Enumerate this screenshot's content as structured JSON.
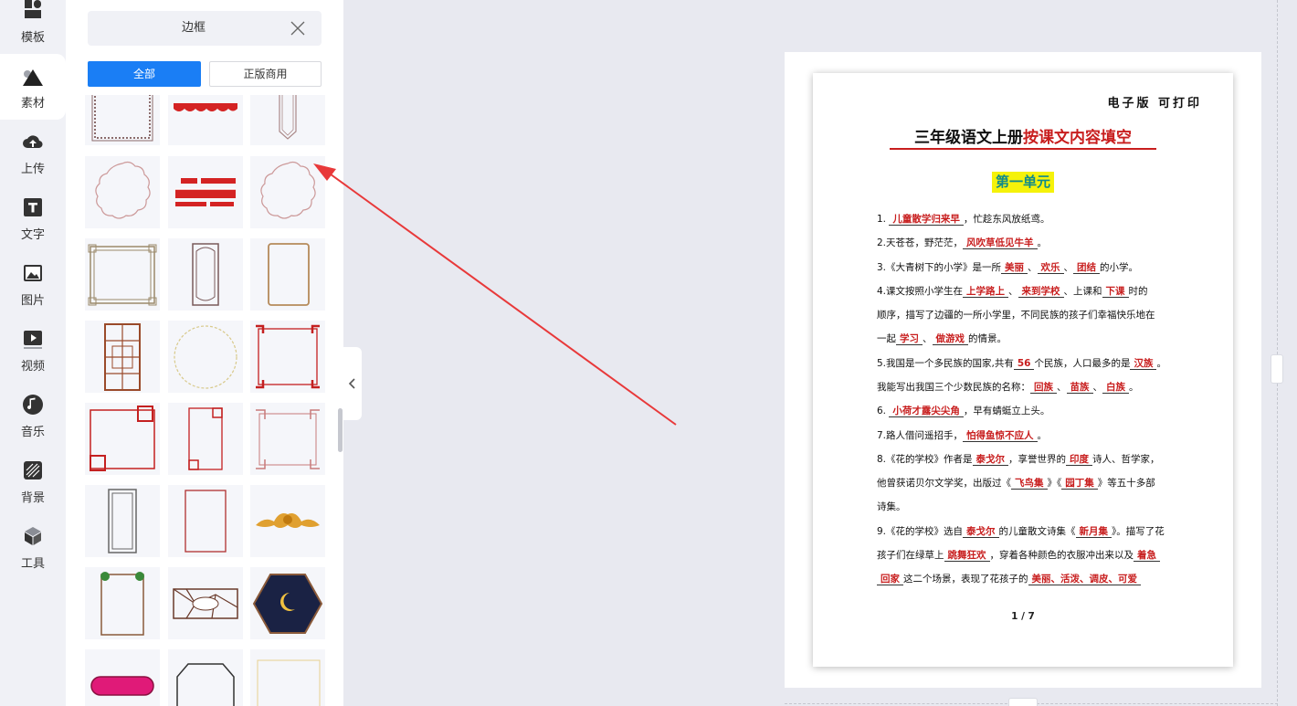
{
  "nav": {
    "items": [
      {
        "label": "模板",
        "icon": "template-icon"
      },
      {
        "label": "素材",
        "icon": "material-icon"
      },
      {
        "label": "上传",
        "icon": "upload-cloud-icon"
      },
      {
        "label": "文字",
        "icon": "text-icon"
      },
      {
        "label": "图片",
        "icon": "image-icon"
      },
      {
        "label": "视频",
        "icon": "video-icon"
      },
      {
        "label": "音乐",
        "icon": "music-icon"
      },
      {
        "label": "背景",
        "icon": "background-icon"
      },
      {
        "label": "工具",
        "icon": "tools-icon"
      }
    ],
    "active": "素材"
  },
  "panel": {
    "search_value": "边框",
    "tabs": [
      {
        "label": "全部",
        "active": true
      },
      {
        "label": "正版商用",
        "active": false
      }
    ]
  },
  "document": {
    "corner_note": "电子版 可打印",
    "title_black": "三年级语文上册",
    "title_red": "按课文内容填空",
    "unit_heading": "第一单元",
    "lines": [
      [
        {
          "t": "1. "
        },
        {
          "a": "儿童散学归来早"
        },
        {
          "t": "，忙趁东风放纸鸢。"
        }
      ],
      [
        {
          "t": "2.天苍苍，野茫茫，"
        },
        {
          "a": "风吹草低见牛羊"
        },
        {
          "t": "。"
        }
      ],
      [
        {
          "t": "3.《大青树下的小学》是一所"
        },
        {
          "a": "美丽"
        },
        {
          "t": "、"
        },
        {
          "a": "欢乐"
        },
        {
          "t": "、"
        },
        {
          "a": "团结"
        },
        {
          "t": "的小学。"
        }
      ],
      [
        {
          "t": "4.课文按照小学生在"
        },
        {
          "a": "上学路上"
        },
        {
          "t": "、"
        },
        {
          "a": "来到学校"
        },
        {
          "t": "、上课和"
        },
        {
          "a": "下课"
        },
        {
          "t": "时的"
        }
      ],
      [
        {
          "t": "顺序，描写了边疆的一所小学里，不同民族的孩子们幸福快乐地在"
        }
      ],
      [
        {
          "t": "一起"
        },
        {
          "a": "学习"
        },
        {
          "t": "、"
        },
        {
          "a": "做游戏"
        },
        {
          "t": "的情景。"
        }
      ],
      [
        {
          "t": "5.我国是一个多民族的国家,共有"
        },
        {
          "a": "56"
        },
        {
          "t": "个民族，人口最多的是"
        },
        {
          "a": "汉族"
        },
        {
          "t": "。"
        }
      ],
      [
        {
          "t": "我能写出我国三个少数民族的名称："
        },
        {
          "a": "回族"
        },
        {
          "t": "、"
        },
        {
          "a": "苗族"
        },
        {
          "t": "、"
        },
        {
          "a": "白族"
        },
        {
          "t": "。"
        }
      ],
      [
        {
          "t": "6. "
        },
        {
          "a": "小荷才露尖尖角"
        },
        {
          "t": "，早有蜻蜓立上头。"
        }
      ],
      [
        {
          "t": "7.路人借问遥招手，"
        },
        {
          "a": "怕得鱼惊不应人"
        },
        {
          "t": "。"
        }
      ],
      [
        {
          "t": "8.《花的学校》作者是"
        },
        {
          "a": "泰戈尔"
        },
        {
          "t": "，享誉世界的"
        },
        {
          "a": "印度"
        },
        {
          "t": "诗人、哲学家，"
        }
      ],
      [
        {
          "t": "他曾获诺贝尔文学奖，出版过《"
        },
        {
          "a": "飞鸟集"
        },
        {
          "t": "》《"
        },
        {
          "a": "园丁集"
        },
        {
          "t": "》等五十多部"
        }
      ],
      [
        {
          "t": "诗集。"
        }
      ],
      [
        {
          "t": "9.《花的学校》选自"
        },
        {
          "a": "泰戈尔"
        },
        {
          "t": "的儿童散文诗集《"
        },
        {
          "a": "新月集"
        },
        {
          "t": "》。描写了花"
        }
      ],
      [
        {
          "t": "孩子们在绿草上"
        },
        {
          "a": "跳舞狂欢"
        },
        {
          "t": "，穿着各种颜色的衣服冲出来以及"
        },
        {
          "a": "着急"
        }
      ],
      [
        {
          "a": "回家"
        },
        {
          "t": "这二个场景，表现了花孩子的"
        },
        {
          "a": "美丽、活泼、调皮、可爱"
        }
      ]
    ],
    "page_indicator": "1 / 7"
  },
  "colors": {
    "accent": "#1a7ef5",
    "answer_red": "#c81e1e",
    "highlight_yellow": "#f5f20a"
  }
}
